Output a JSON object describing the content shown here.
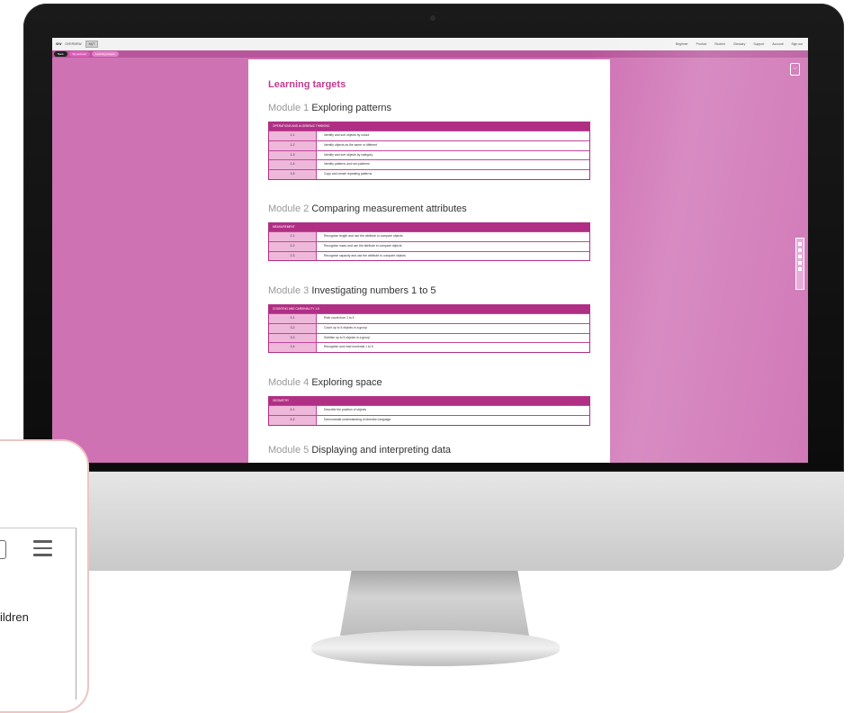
{
  "app": {
    "brand": "SIW",
    "tabs": [
      "OVERVIEW",
      "MyT"
    ],
    "menu": [
      "Beginner",
      "Product",
      "Student",
      "Glossary",
      "Support",
      "Account",
      "Sign out"
    ]
  },
  "breadcrumbs": [
    "Back",
    "My account",
    "Learning targets"
  ],
  "document": {
    "title": "Learning targets",
    "modules": [
      {
        "num": "Module 1",
        "name": "Exploring patterns",
        "table_header": "Operations and algebraic thinking",
        "rows": [
          {
            "code": "1.1",
            "desc": "Identify and sort objects by colour"
          },
          {
            "code": "1.2",
            "desc": "Identify objects as the same or different"
          },
          {
            "code": "1.3",
            "desc": "Identify and sort objects by category"
          },
          {
            "code": "1.4",
            "desc": "Identify patterns and non-patterns"
          },
          {
            "code": "1.5",
            "desc": "Copy and create repeating patterns"
          }
        ]
      },
      {
        "num": "Module 2",
        "name": "Comparing measurement attributes",
        "table_header": "Measurement",
        "rows": [
          {
            "code": "2.1",
            "desc": "Recognise length and use the attribute to compare objects"
          },
          {
            "code": "2.2",
            "desc": "Recognise mass and use the attribute to compare objects"
          },
          {
            "code": "2.3",
            "desc": "Recognise capacity and use the attribute to compare objects"
          }
        ]
      },
      {
        "num": "Module 3",
        "name": "Investigating numbers 1 to 5",
        "table_header": "Counting and cardinality 1-5",
        "rows": [
          {
            "code": "3.1",
            "desc": "Rote count from 1 to 5"
          },
          {
            "code": "3.2",
            "desc": "Count up to 5 objects in a group"
          },
          {
            "code": "3.3",
            "desc": "Subitise up to 5 objects in a group"
          },
          {
            "code": "3.4",
            "desc": "Recognise and read numerals 1 to 5"
          }
        ]
      },
      {
        "num": "Module 4",
        "name": "Exploring space",
        "table_header": "Geometry",
        "rows": [
          {
            "code": "4.1",
            "desc": "Describe the position of objects"
          },
          {
            "code": "4.2",
            "desc": "Demonstrate understanding of direction language"
          }
        ]
      },
      {
        "num": "Module 5",
        "name": "Displaying and interpreting data"
      }
    ]
  },
  "phone": {
    "visible_text": "ildren"
  },
  "colors": {
    "screen_bg": "#cf72b4",
    "accent": "#b02f84",
    "title": "#c13c8f",
    "row_code_bg": "#eeb8da"
  },
  "icons": [
    "expand-icon",
    "square-icon",
    "hamburger-icon"
  ]
}
